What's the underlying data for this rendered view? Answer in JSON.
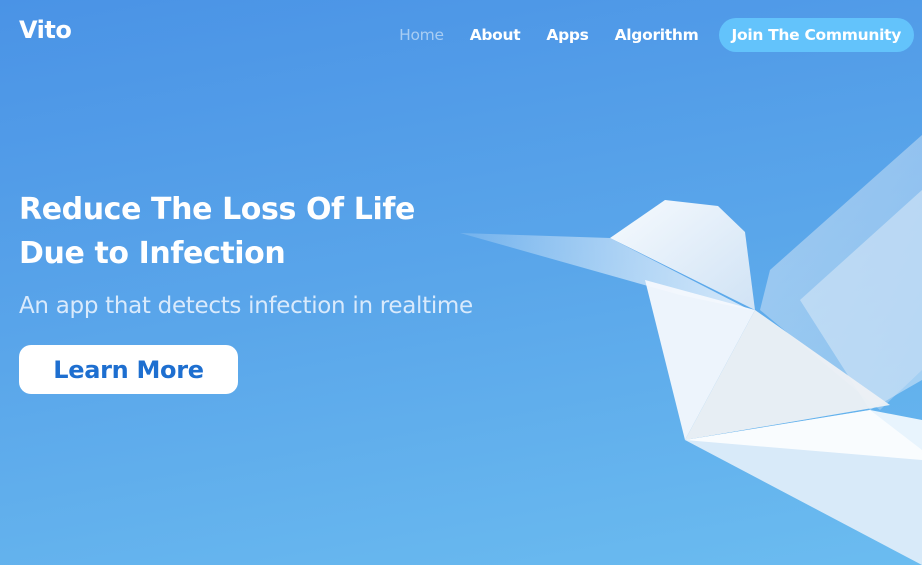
{
  "header": {
    "logo": "Vito",
    "nav": [
      {
        "label": "Home",
        "active": true
      },
      {
        "label": "About",
        "active": false
      },
      {
        "label": "Apps",
        "active": false
      },
      {
        "label": "Algorithm",
        "active": false
      }
    ],
    "cta_label": "Join The Community"
  },
  "hero": {
    "title_line1": "Reduce The Loss Of Life",
    "title_line2": "Due to Infection",
    "subtitle": "An app that detects infection in realtime",
    "button_label": "Learn More"
  },
  "illustration": {
    "icon": "origami-bird-icon"
  },
  "colors": {
    "accent": "#63c3fb",
    "button_text": "#1e6fd0",
    "background_top": "#4a93e6",
    "background_bottom": "#6bbcf0"
  }
}
